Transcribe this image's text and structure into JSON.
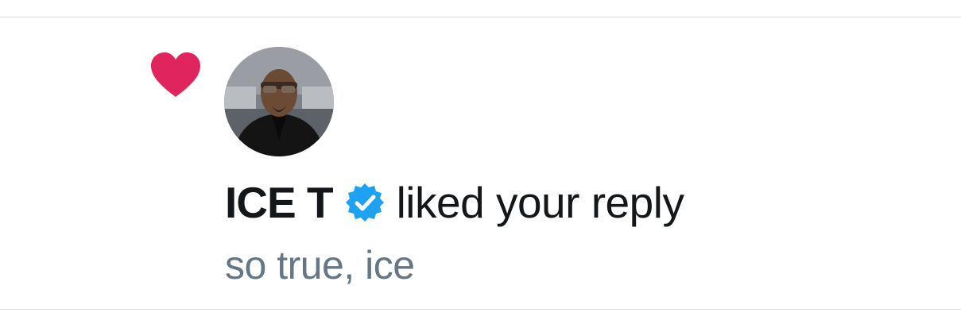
{
  "notification": {
    "type_icon": "heart-icon",
    "avatar_icon": "user-avatar",
    "author_name": "ICE T",
    "verified_icon": "verified-badge-icon",
    "action_text": "liked your reply",
    "reply_text": "so true, ice"
  },
  "colors": {
    "heart": "#e0245e",
    "verified": "#1da1f2",
    "primary_text": "#14171a",
    "secondary_text": "#657786",
    "divider": "#d9d9de"
  }
}
